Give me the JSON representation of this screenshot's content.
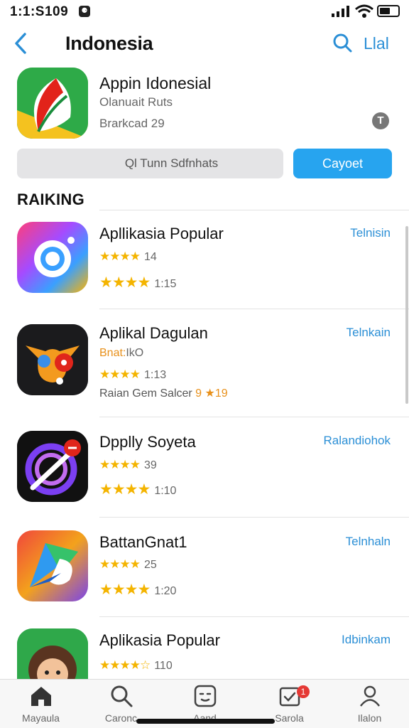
{
  "status": {
    "time": "1:1:S109",
    "camera_glyph": "⚈"
  },
  "nav": {
    "title": "Indonesia",
    "right_label": "Llal",
    "search_icon": "search-icon",
    "back_icon": "chevron-left-icon"
  },
  "featured": {
    "title": "Appin Idonesial",
    "subtitle": "Olanuait Ruts",
    "meta": "Brarkcad 29",
    "info_glyph": "T",
    "secondary_button": "Ql Tunn Sdfnhats",
    "primary_button": "Cayoet"
  },
  "section_title": "RAIKING",
  "apps": [
    {
      "name": "Apllikasia Popular",
      "line1_stars": "★★★★",
      "line1_text": "14",
      "line2_stars": "★★★★",
      "line2_text": "1:15",
      "line3": "",
      "action": "Telnisin"
    },
    {
      "name": "Aplikal Dagulan",
      "line1_prefix": "Bnat:",
      "line1_text": "IkO",
      "line2_stars": "★★★★",
      "line2_text": "1:13",
      "line3": "Raian Gem Salcer",
      "line3_rating": "9 ★19",
      "action": "Telnkain"
    },
    {
      "name": "Dpplly Soyeta",
      "line1_stars": "★★★★",
      "line1_text": "39",
      "line2_stars": "★★★★",
      "line2_text": "1:10",
      "line3": "",
      "action": "Ralandiohok"
    },
    {
      "name": "BattanGnat1",
      "line1_stars": "★★★★",
      "line1_text": "25",
      "line2_stars": "★★★★",
      "line2_text": "1:20",
      "line3": "",
      "action": "Telnhaln"
    },
    {
      "name": "Aplikasia Popular",
      "line1_stars": "★★★★☆",
      "line1_text": "110",
      "action": "Idbinkam"
    }
  ],
  "tabs": [
    {
      "label": "Mayaula",
      "icon": "home-icon"
    },
    {
      "label": "Caronc",
      "icon": "search-icon"
    },
    {
      "label": "Aand",
      "icon": "face-icon"
    },
    {
      "label": "Sarola",
      "icon": "updates-icon",
      "badge": "1"
    },
    {
      "label": "Ilalon",
      "icon": "person-icon"
    }
  ],
  "colors": {
    "accent": "#2b8fd6",
    "primary_button": "#27a4ef",
    "star": "#f4b400",
    "badge": "#e53935"
  }
}
